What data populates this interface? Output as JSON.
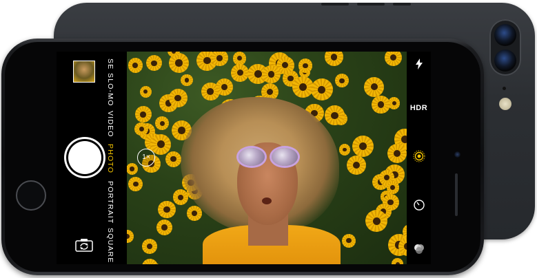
{
  "camera": {
    "modes": [
      {
        "label": "SE",
        "active": false
      },
      {
        "label": "SLO-MO",
        "active": false
      },
      {
        "label": "VIDEO",
        "active": false
      },
      {
        "label": "PHOTO",
        "active": true
      },
      {
        "label": "PORTRAIT",
        "active": false
      },
      {
        "label": "SQUARE",
        "active": false
      }
    ],
    "zoom_label": "1×",
    "hdr_label": "HDR",
    "icons": {
      "flash": "lightning-bolt-icon",
      "live_photo": "live-photo-rings-icon",
      "timer": "timer-icon",
      "filters": "filters-circles-icon",
      "switch_camera": "camera-switch-icon"
    },
    "accent_color": "#f4c400"
  }
}
